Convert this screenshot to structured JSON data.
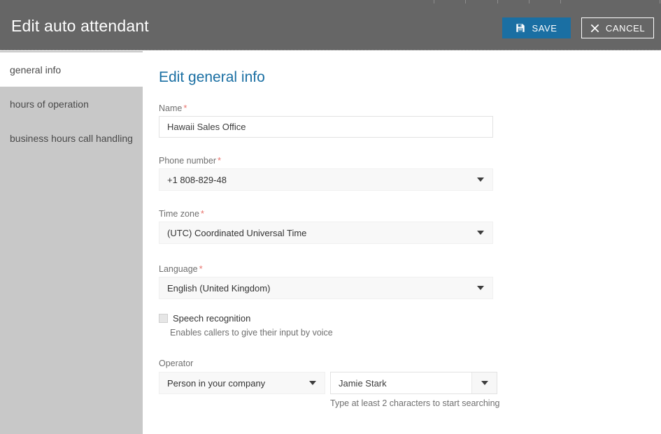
{
  "header": {
    "title": "Edit auto attendant",
    "save_label": "SAVE",
    "save_icon": "save-floppy-icon",
    "cancel_label": "CANCEL",
    "cancel_icon": "close-x-icon",
    "background_color": "#666666",
    "save_button_color": "#1a6fa3"
  },
  "sidebar": {
    "background_color": "#c8c8c8",
    "items": [
      {
        "label": "general info",
        "selected": true
      },
      {
        "label": "hours of operation",
        "selected": false
      },
      {
        "label": "business hours call handling",
        "selected": false
      }
    ]
  },
  "main": {
    "section_title": "Edit general info",
    "section_title_color": "#1a6fa3",
    "required_marker": "*",
    "required_marker_color": "#e8736c",
    "fields": {
      "name": {
        "label": "Name",
        "required": true,
        "value": "Hawaii Sales Office",
        "type": "text"
      },
      "phone_number": {
        "label": "Phone number",
        "required": true,
        "value": "+1 808-829-48",
        "type": "dropdown",
        "caret_icon": "chevron-down-icon"
      },
      "time_zone": {
        "label": "Time zone",
        "required": true,
        "value": "(UTC) Coordinated Universal Time",
        "type": "dropdown",
        "caret_icon": "chevron-down-icon"
      },
      "language": {
        "label": "Language",
        "required": true,
        "value": "English (United Kingdom)",
        "type": "dropdown",
        "caret_icon": "chevron-down-icon"
      },
      "speech_recognition": {
        "label": "Speech recognition",
        "checked": false,
        "help_text": "Enables callers to give their input by voice",
        "type": "checkbox"
      },
      "operator": {
        "label": "Operator",
        "required": false,
        "type_value": "Person in your company",
        "person_value": "Jamie Stark",
        "help_text": "Type at least 2 characters to start searching",
        "caret_icon": "chevron-down-icon"
      }
    }
  }
}
